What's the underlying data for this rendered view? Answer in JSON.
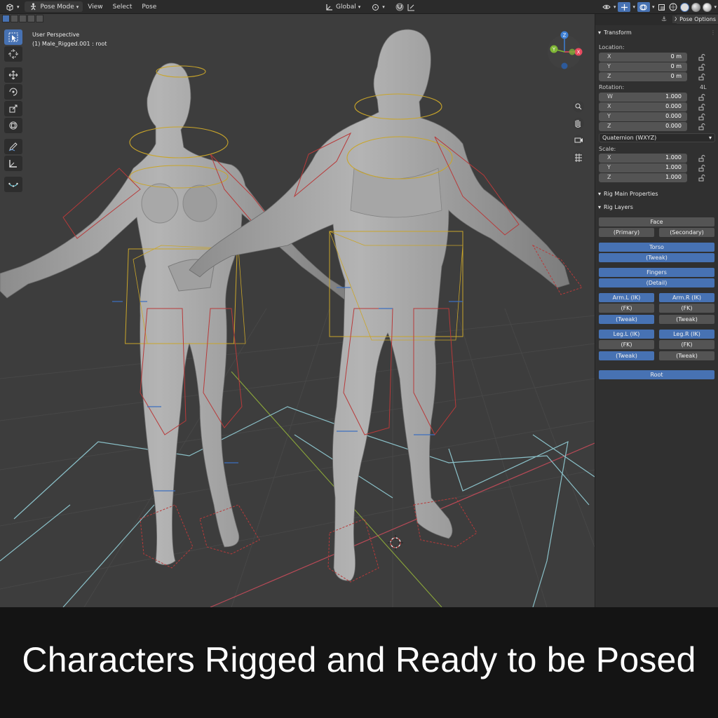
{
  "header": {
    "editor_icon": "view3d-icon",
    "mode": "Pose Mode",
    "menus": [
      "View",
      "Select",
      "Pose"
    ],
    "orientation": "Global"
  },
  "viewport": {
    "perspective_label": "User Perspective",
    "object_label": "(1) Male_Rigged.001 : root"
  },
  "sidebar": {
    "tab_label": "Pose Options",
    "transform": {
      "title": "Transform",
      "location_label": "Location:",
      "location": [
        {
          "axis": "X",
          "value": "0 m"
        },
        {
          "axis": "Y",
          "value": "0 m"
        },
        {
          "axis": "Z",
          "value": "0 m"
        }
      ],
      "rotation_label": "Rotation:",
      "rotation_mode_short": "4L",
      "rotation": [
        {
          "axis": "W",
          "value": "1.000"
        },
        {
          "axis": "X",
          "value": "0.000"
        },
        {
          "axis": "Y",
          "value": "0.000"
        },
        {
          "axis": "Z",
          "value": "0.000"
        }
      ],
      "rotation_mode": "Quaternion (WXYZ)",
      "scale_label": "Scale:",
      "scale": [
        {
          "axis": "X",
          "value": "1.000"
        },
        {
          "axis": "Y",
          "value": "1.000"
        },
        {
          "axis": "Z",
          "value": "1.000"
        }
      ]
    },
    "rig_main_title": "Rig Main Properties",
    "rig_layers": {
      "title": "Rig Layers",
      "face": "Face",
      "primary": "(Primary)",
      "secondary": "(Secondary)",
      "torso": "Torso",
      "torso_tweak": "(Tweak)",
      "fingers": "Fingers",
      "fingers_detail": "(Detail)",
      "arm_l_ik": "Arm.L (IK)",
      "arm_r_ik": "Arm.R (IK)",
      "arm_l_fk": "(FK)",
      "arm_r_fk": "(FK)",
      "arm_l_tweak": "(Tweak)",
      "arm_r_tweak": "(Tweak)",
      "leg_l_ik": "Leg.L (IK)",
      "leg_r_ik": "Leg.R (IK)",
      "leg_l_fk": "(FK)",
      "leg_r_fk": "(FK)",
      "leg_l_tweak": "(Tweak)",
      "leg_r_tweak": "(Tweak)",
      "root": "Root"
    }
  },
  "gizmo": {
    "x": "X",
    "y": "Y",
    "z": "Z"
  },
  "caption": "Characters Rigged and Ready to be Posed",
  "colors": {
    "accent": "#4772b3",
    "viewport_bg": "#3d3d3d",
    "panel_bg": "#303030",
    "axis_x": "#e84a5f",
    "axis_y": "#7fb635",
    "axis_z": "#3d7fd4"
  }
}
